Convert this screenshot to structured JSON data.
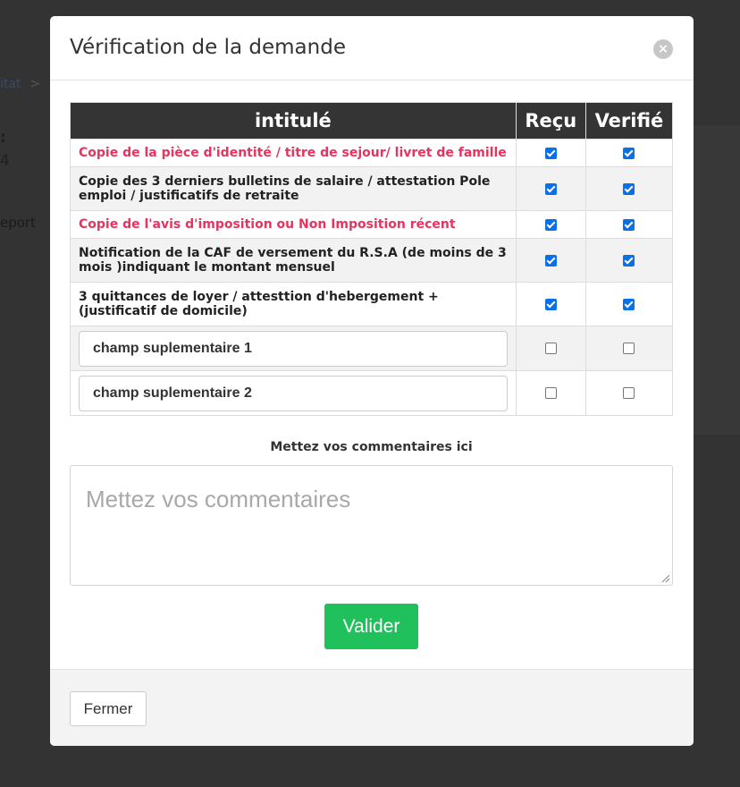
{
  "background": {
    "breadcrumb_text": "itat",
    "breadcrumb_sep": ">",
    "colon": ":",
    "number": "4",
    "report_text": "eport"
  },
  "modal": {
    "title": "Vérification de la demande",
    "close_icon": "×",
    "table": {
      "headers": [
        "intitulé",
        "Reçu",
        "Verifié"
      ],
      "rows": [
        {
          "label": "Copie de la pièce d'identité / titre de sejour/ livret de famille",
          "highlight": true,
          "received": true,
          "verified": true
        },
        {
          "label": "Copie des 3 derniers bulletins de salaire / attestation Pole emploi / justificatifs de retraite",
          "highlight": false,
          "received": true,
          "verified": true
        },
        {
          "label": "Copie de l'avis d'imposition ou Non Imposition récent",
          "highlight": true,
          "received": true,
          "verified": true
        },
        {
          "label": "Notification de la CAF de versement du R.S.A (de moins de 3 mois )indiquant le montant mensuel",
          "highlight": false,
          "received": true,
          "verified": true
        },
        {
          "label": "3 quittances de loyer / attesttion d'hebergement + (justificatif de domicile)",
          "highlight": false,
          "received": true,
          "verified": true
        }
      ],
      "extra_fields": [
        {
          "value": "champ suplementaire 1",
          "received": false,
          "verified": false
        },
        {
          "value": "champ suplementaire 2",
          "received": false,
          "verified": false
        }
      ]
    },
    "comment_label": "Mettez vos commentaires ici",
    "comment_placeholder": "Mettez vos commentaires",
    "submit_label": "Valider",
    "close_label": "Fermer"
  },
  "colors": {
    "highlight_text": "#e8335f",
    "header_bg": "#343434",
    "submit_bg": "#20c05c",
    "checkbox_checked": "#0b6fe8"
  }
}
